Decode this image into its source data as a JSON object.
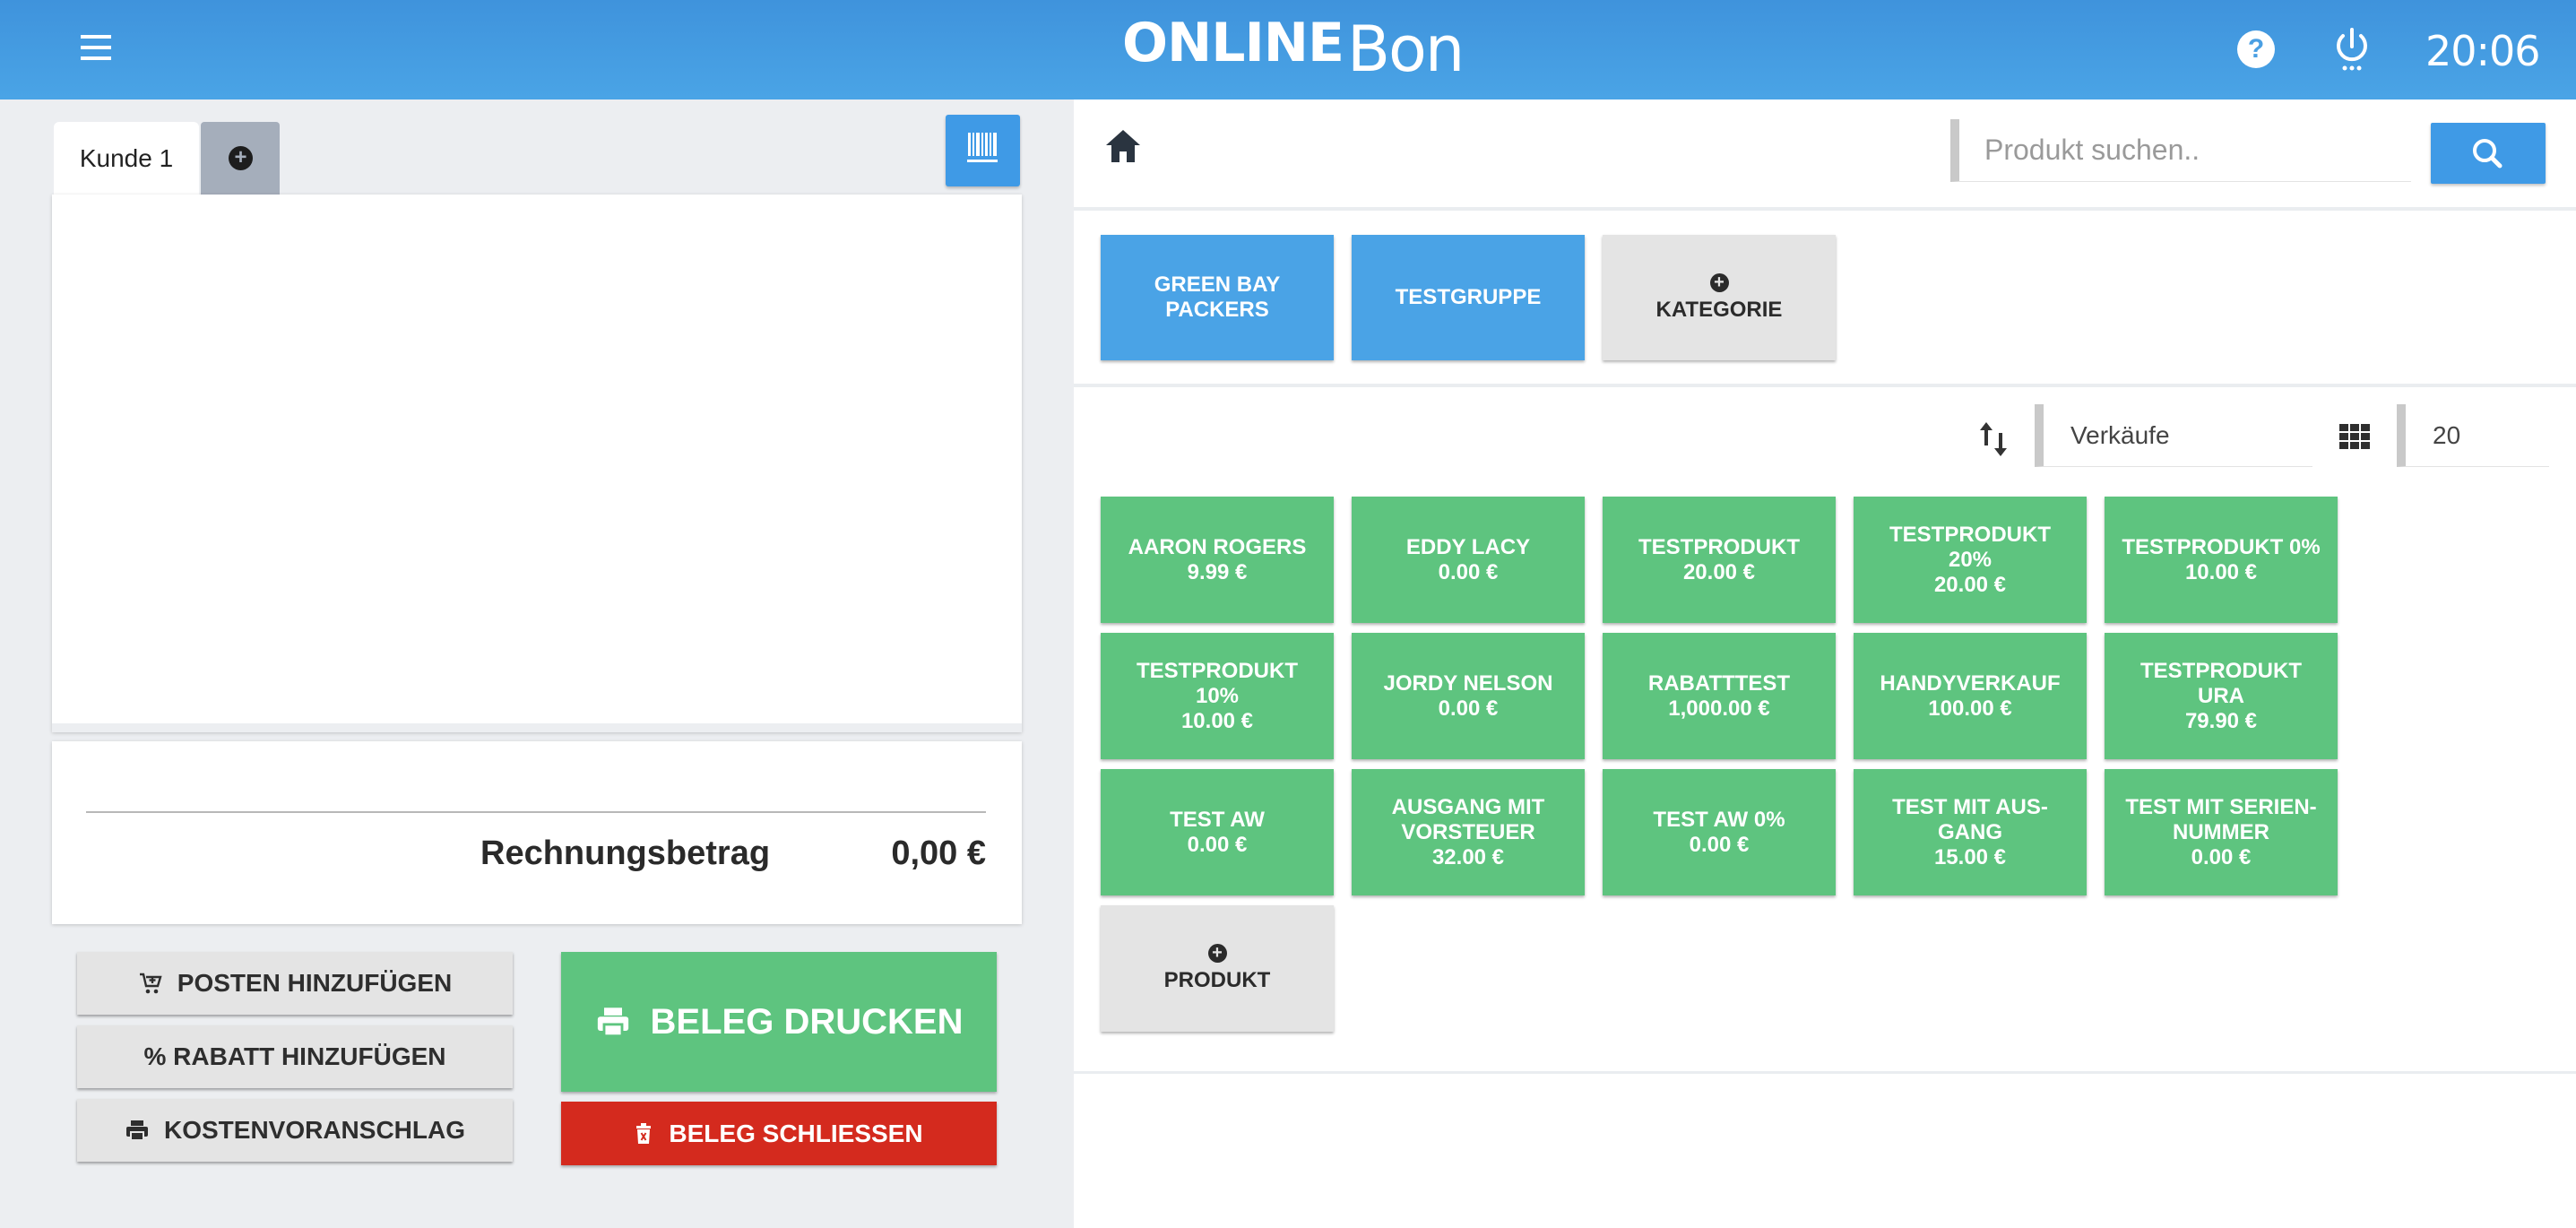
{
  "header": {
    "logo_bold": "ONLINE",
    "logo_light": "Bon",
    "help_symbol": "?",
    "clock": "20:06",
    "icons": {
      "menu": "hamburger-menu-icon",
      "help": "help-circle-icon",
      "power": "power-icon"
    },
    "colors": {
      "background": "#4aa3e6"
    }
  },
  "customer_tabs": {
    "active_label": "Kunde 1",
    "add_symbol": "+"
  },
  "receipt": {
    "items": [],
    "total_label": "Rechnungsbetrag",
    "total_value": "0,00 €"
  },
  "actions": {
    "add_item": "POSTEN HINZUFÜGEN",
    "add_discount": "% RABATT HINZUFÜGEN",
    "estimate": "KOSTENVORANSCHLAG",
    "print_receipt": "BELEG DRUCKEN",
    "close_receipt": "BELEG SCHLIESSEN",
    "colors": {
      "print": "#5ec47f",
      "close": "#d42a1e"
    }
  },
  "search": {
    "placeholder": "Produkt suchen..",
    "value": ""
  },
  "categories": [
    {
      "label": "GREEN BAY PACKERS"
    },
    {
      "label": "TESTGRUPPE"
    }
  ],
  "add_category_label": "KATEGORIE",
  "sort": {
    "label": "Verkäufe",
    "page_size": "20"
  },
  "products": [
    {
      "name": "AARON ROGERS",
      "price": "9.99 €"
    },
    {
      "name": "EDDY LACY",
      "price": "0.00 €"
    },
    {
      "name": "TESTPRODUKT",
      "price": "20.00 €"
    },
    {
      "name": "TESTPRODUKT 20%",
      "price": "20.00 €"
    },
    {
      "name": "TESTPRODUKT 0%",
      "price": "10.00 €"
    },
    {
      "name": "TESTPRODUKT 10%",
      "price": "10.00 €"
    },
    {
      "name": "JORDY NELSON",
      "price": "0.00 €"
    },
    {
      "name": "RABATTTEST",
      "price": "1,000.00 €"
    },
    {
      "name": "HANDYVERKAUF",
      "price": "100.00 €"
    },
    {
      "name": "TESTPRODUKT URA",
      "price": "79.90 €"
    },
    {
      "name": "TEST AW",
      "price": "0.00 €"
    },
    {
      "name": "AUSGANG MIT VORSTEUER",
      "price": "32.00 €"
    },
    {
      "name": "TEST AW 0%",
      "price": "0.00 €"
    },
    {
      "name": "TEST MIT AUS-GANG",
      "price": "15.00 €"
    },
    {
      "name": "TEST MIT SERIEN-NUMMER",
      "price": "0.00 €"
    }
  ],
  "add_product_label": "PRODUKT",
  "colors": {
    "product_tile": "#5ec47f",
    "category_tile": "#4aa3e6",
    "neutral_tile": "#e4e4e4"
  }
}
